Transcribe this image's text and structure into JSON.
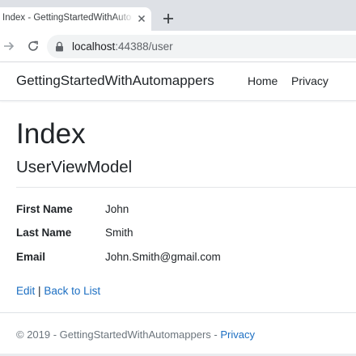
{
  "browser": {
    "tab_title": "Index - GettingStartedWithAutomappers",
    "new_tab_icon": "plus-icon",
    "url_host": "localhost",
    "url_rest": ":44388/user"
  },
  "navbar": {
    "brand": "GettingStartedWithAutomappers",
    "links": [
      "Home",
      "Privacy"
    ]
  },
  "page": {
    "title": "Index",
    "subtitle": "UserViewModel",
    "fields": [
      {
        "label": "First Name",
        "value": "John"
      },
      {
        "label": "Last Name",
        "value": "Smith"
      },
      {
        "label": "Email",
        "value": "John.Smith@gmail.com"
      }
    ],
    "actions": {
      "edit": "Edit",
      "separator": "|",
      "back": "Back to List"
    }
  },
  "footer": {
    "text": "© 2019 - GettingStartedWithAutomappers - ",
    "privacy": "Privacy"
  },
  "colors": {
    "link": "#1b6ec2",
    "tabstrip": "#dee1e6",
    "omnibox": "#f1f3f4",
    "footer_text": "#6c757d"
  }
}
